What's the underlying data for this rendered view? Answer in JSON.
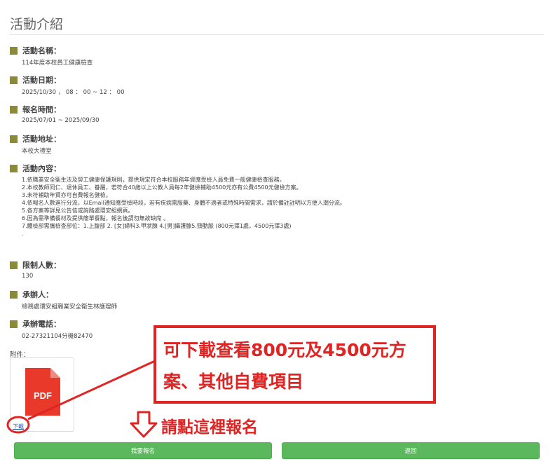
{
  "page": {
    "title": "活動介紹"
  },
  "fields": {
    "name": {
      "label": "活動名稱：",
      "value": "114年度本校員工健康檢查"
    },
    "date": {
      "label": "活動日期：",
      "value": "2025/10/30 ， 08 ： 00 ~ 12 ： 00"
    },
    "registration": {
      "label": "報名時間：",
      "value": "2025/07/01 ~ 2025/09/30"
    },
    "location": {
      "label": "活動地址：",
      "value": "本校大禮堂"
    },
    "content": {
      "label": "活動內容：",
      "lines": [
        "1.依職業安全衛生法及勞工健康保護規則，提供規定符合本校服務年資應受檢人員免費一般健康檢查服務。",
        "2.本校教師同仁、退休員工、眷屬，若符合40歲以上公教人員每2年健檢補助4500元亦有公費4500元健檢方案。",
        "3.未符補助年資亦可自費報名健檢。",
        "4.依報名人數進行分流，以Email通知應受檢時段，若有疾病需服藥、身體不適者或特殊時間需求，請於備註註明以方便人潮分流。",
        "5.各方案等詳見公告信或詢路處環安組網頁。",
        "6.因為需準備餐材及提供簡單餐點，報名後請勿無故缺席 。",
        "7.體檢部需攜檢查部位：1.上腹部 2. [女]婦科3.甲狀腺 4.[男]攝護腺5.頸動脈 (800元擇1處，4500元擇3處)",
        "."
      ]
    },
    "capacity": {
      "label": "限制人數：",
      "value": "130"
    },
    "organizer": {
      "label": "承辦人：",
      "value": "總務處環安組職業安全衛生林護理師"
    },
    "phone": {
      "label": "承辦電話：",
      "value": "02-27321104分機82470"
    }
  },
  "attachments": {
    "label": "附件：",
    "file_badge": "PDF",
    "download_label": "下載"
  },
  "buttons": {
    "signup": "我要報名",
    "back": "返回"
  },
  "annotations": {
    "callout_line1": "可下載查看800元及4500元方",
    "callout_line2": "案、其他自費項目",
    "signup_hint": "請點這裡報名",
    "color": "#e02424"
  },
  "colors": {
    "marker": "#8a8a3a",
    "button": "#5cb85c",
    "link": "#2a5db0",
    "pdf": "#e8392b"
  }
}
